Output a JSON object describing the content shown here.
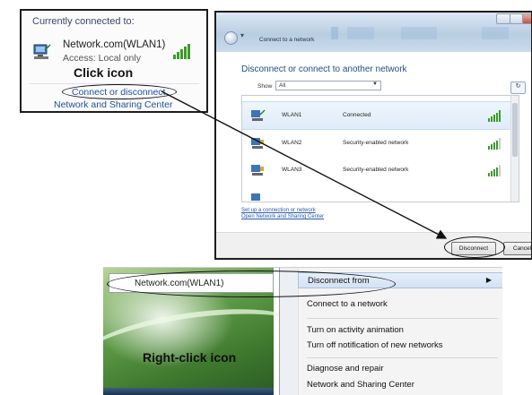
{
  "popup": {
    "header": "Currently connected to:",
    "network_name": "Network.com(WLAN1)",
    "access": "Access:  Local only",
    "instruction": "Click icon",
    "link_connect": "Connect or disconnect",
    "link_center": "Network and Sharing Center"
  },
  "dialog": {
    "title": "Connect to a network",
    "heading": "Disconnect or connect to another network",
    "show_label": "Show",
    "show_value": "All",
    "networks": [
      {
        "name": "WLAN1",
        "status": "Connected",
        "signal_bars": 5
      },
      {
        "name": "WLAN2",
        "status": "Security-enabled network",
        "signal_bars": 4
      },
      {
        "name": "WLAN3",
        "status": "Security-enabled network",
        "signal_bars": 4
      }
    ],
    "link_setup": "Set up a connection or network",
    "link_center": "Open Network and Sharing Center",
    "button_disconnect": "Disconnect",
    "button_cancel": "Cancel"
  },
  "context": {
    "tooltip": "Network.com(WLAN1)",
    "instruction": "Right-click icon",
    "menu_items": [
      "Disconnect from",
      "Connect to a network",
      "Turn on activity animation",
      "Turn off notification of new networks",
      "Diagnose and repair",
      "Network and Sharing Center"
    ]
  },
  "colors": {
    "link": "#1f4f9d",
    "signal": "#3c9b2a",
    "heading": "#234c85"
  }
}
